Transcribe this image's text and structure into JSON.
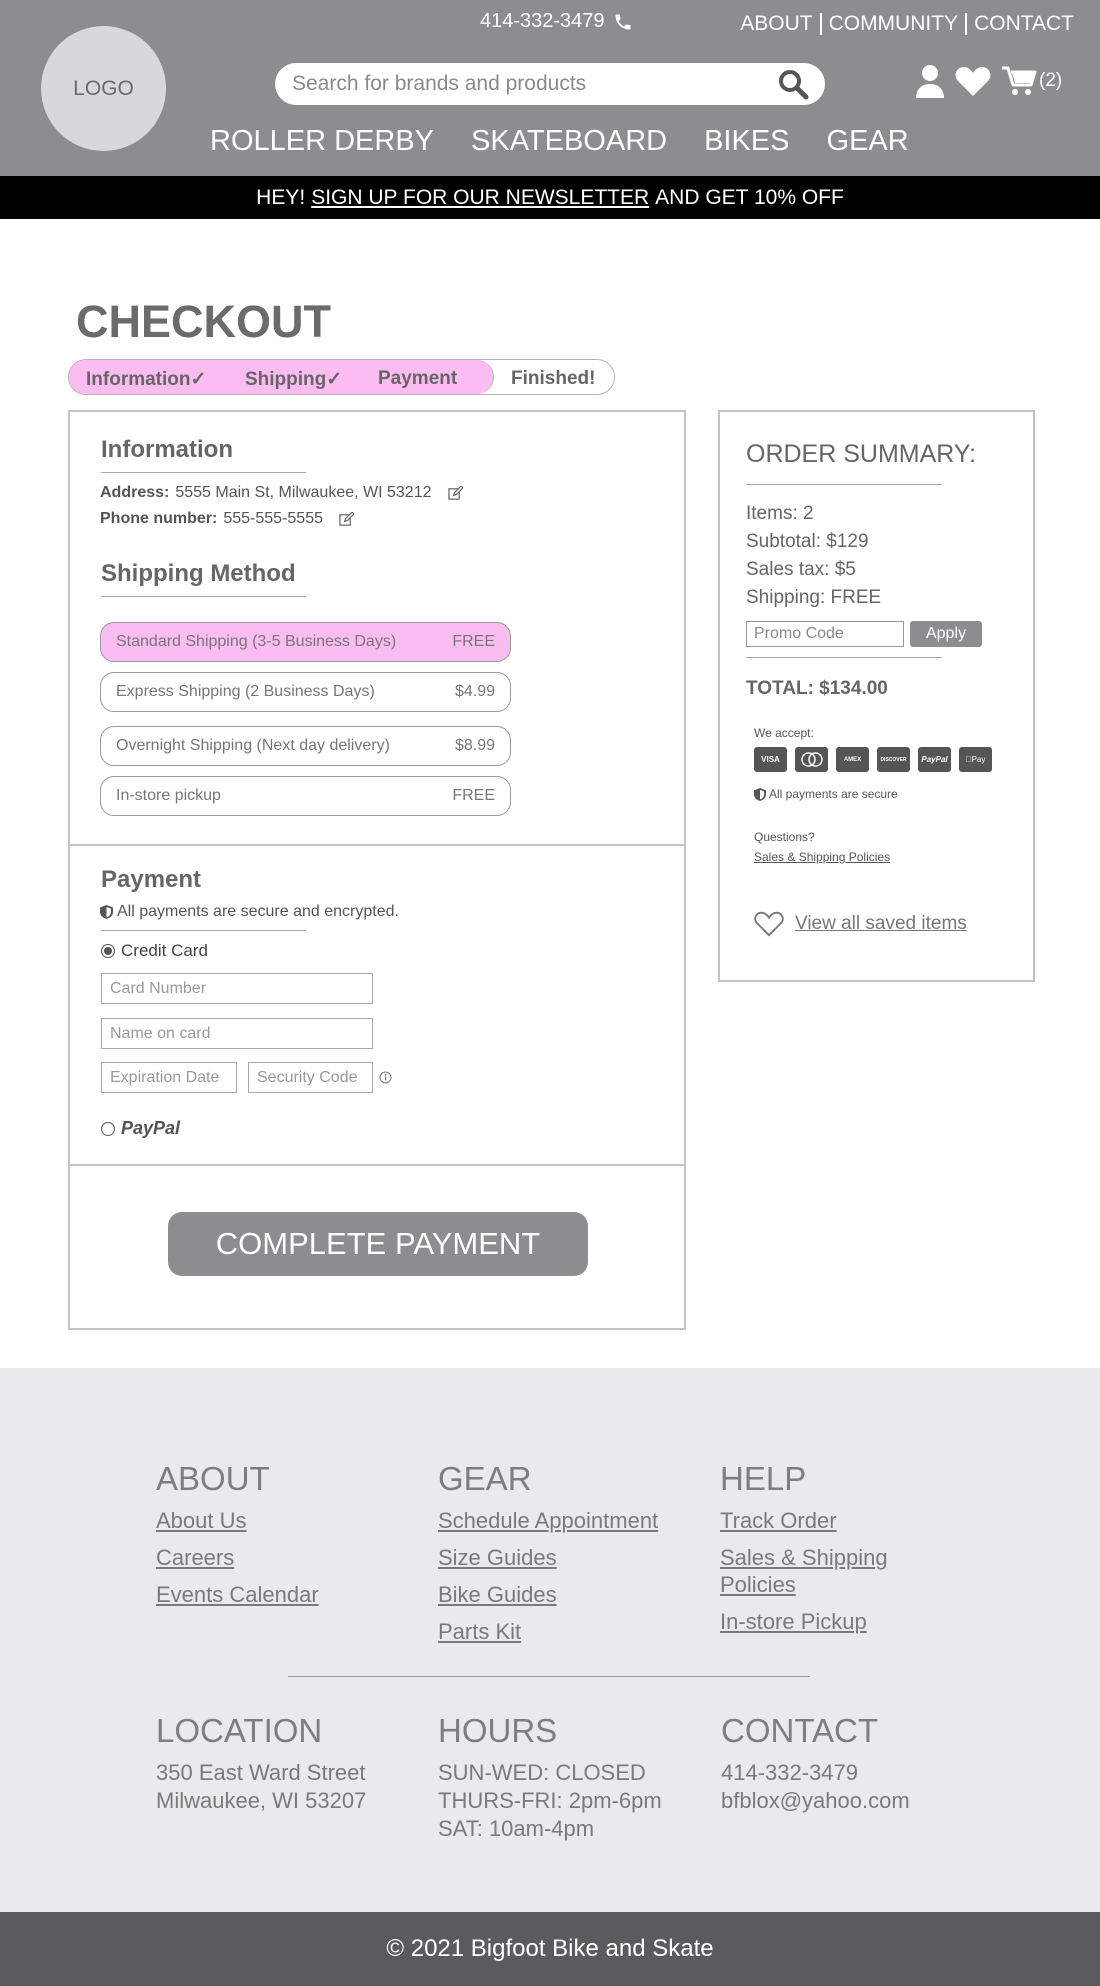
{
  "header": {
    "logo_text": "LOGO",
    "phone": "414-332-3479",
    "top_links": [
      "ABOUT",
      "COMMUNITY",
      "CONTACT"
    ],
    "search_placeholder": "Search for brands and products",
    "cart_count": "(2)",
    "nav": [
      "ROLLER DERBY",
      "SKATEBOARD",
      "BIKES",
      "GEAR"
    ],
    "colors": {
      "bar": "#8d8d8f",
      "banner": "#000000",
      "accent_pink": "#fbbcf2"
    }
  },
  "banner": {
    "prefix": "HEY!",
    "link": "SIGN UP FOR OUR NEWSLETTER",
    "suffix": "AND GET 10% OFF"
  },
  "checkout": {
    "title": "CHECKOUT",
    "steps": [
      "Information",
      "Shipping",
      "Payment",
      "Finished!"
    ],
    "information": {
      "heading": "Information",
      "address_label": "Address:",
      "address": "5555 Main St, Milwaukee, WI 53212",
      "phone_label": "Phone number:",
      "phone": "555-555-5555"
    },
    "shipping": {
      "heading": "Shipping Method",
      "options": [
        {
          "label": "Standard Shipping (3-5 Business Days)",
          "price": "FREE"
        },
        {
          "label": "Express Shipping (2 Business Days)",
          "price": "$4.99"
        },
        {
          "label": "Overnight Shipping (Next day delivery)",
          "price": "$8.99"
        },
        {
          "label": "In-store pickup",
          "price": "FREE"
        }
      ]
    },
    "payment": {
      "heading": "Payment",
      "secure_note": "All payments are secure and encrypted.",
      "credit_card_label": "Credit Card",
      "card_number_placeholder": "Card Number",
      "name_placeholder": "Name on card",
      "expiration_placeholder": "Expiration Date",
      "security_placeholder": "Security Code",
      "paypal_label": "PayPal"
    },
    "complete_button": "COMPLETE PAYMENT"
  },
  "summary": {
    "heading": "ORDER SUMMARY:",
    "items": "Items: 2",
    "subtotal": "Subtotal: $129",
    "tax": "Sales tax: $5",
    "shipping": "Shipping: FREE",
    "promo_placeholder": "Promo Code",
    "apply": "Apply",
    "total": "TOTAL: $134.00",
    "we_accept": "We accept:",
    "cards": [
      "VISA",
      "MC",
      "AMEX",
      "DISCOVER",
      "PayPal",
      "Pay"
    ],
    "secure": "All payments are secure",
    "questions": "Questions?",
    "policies_link": "Sales & Shipping Policies",
    "saved_link": "View all saved items"
  },
  "footer": {
    "about": {
      "heading": "ABOUT",
      "links": [
        "About Us",
        "Careers",
        "Events Calendar"
      ]
    },
    "gear": {
      "heading": "GEAR",
      "links": [
        "Schedule Appointment",
        "Size Guides",
        "Bike Guides",
        "Parts Kit"
      ]
    },
    "help": {
      "heading": "HELP",
      "links": [
        "Track Order",
        "Sales & Shipping Policies",
        "In-store Pickup"
      ]
    },
    "location": {
      "heading": "LOCATION",
      "lines": [
        "350 East Ward Street",
        "Milwaukee, WI 53207"
      ]
    },
    "hours": {
      "heading": "HOURS",
      "lines": [
        "SUN-WED: CLOSED",
        "THURS-FRI: 2pm-6pm",
        "SAT: 10am-4pm"
      ]
    },
    "contact": {
      "heading": "CONTACT",
      "lines": [
        "414-332-3479",
        "bfblox@yahoo.com"
      ]
    },
    "copyright": "© 2021 Bigfoot Bike and Skate"
  }
}
